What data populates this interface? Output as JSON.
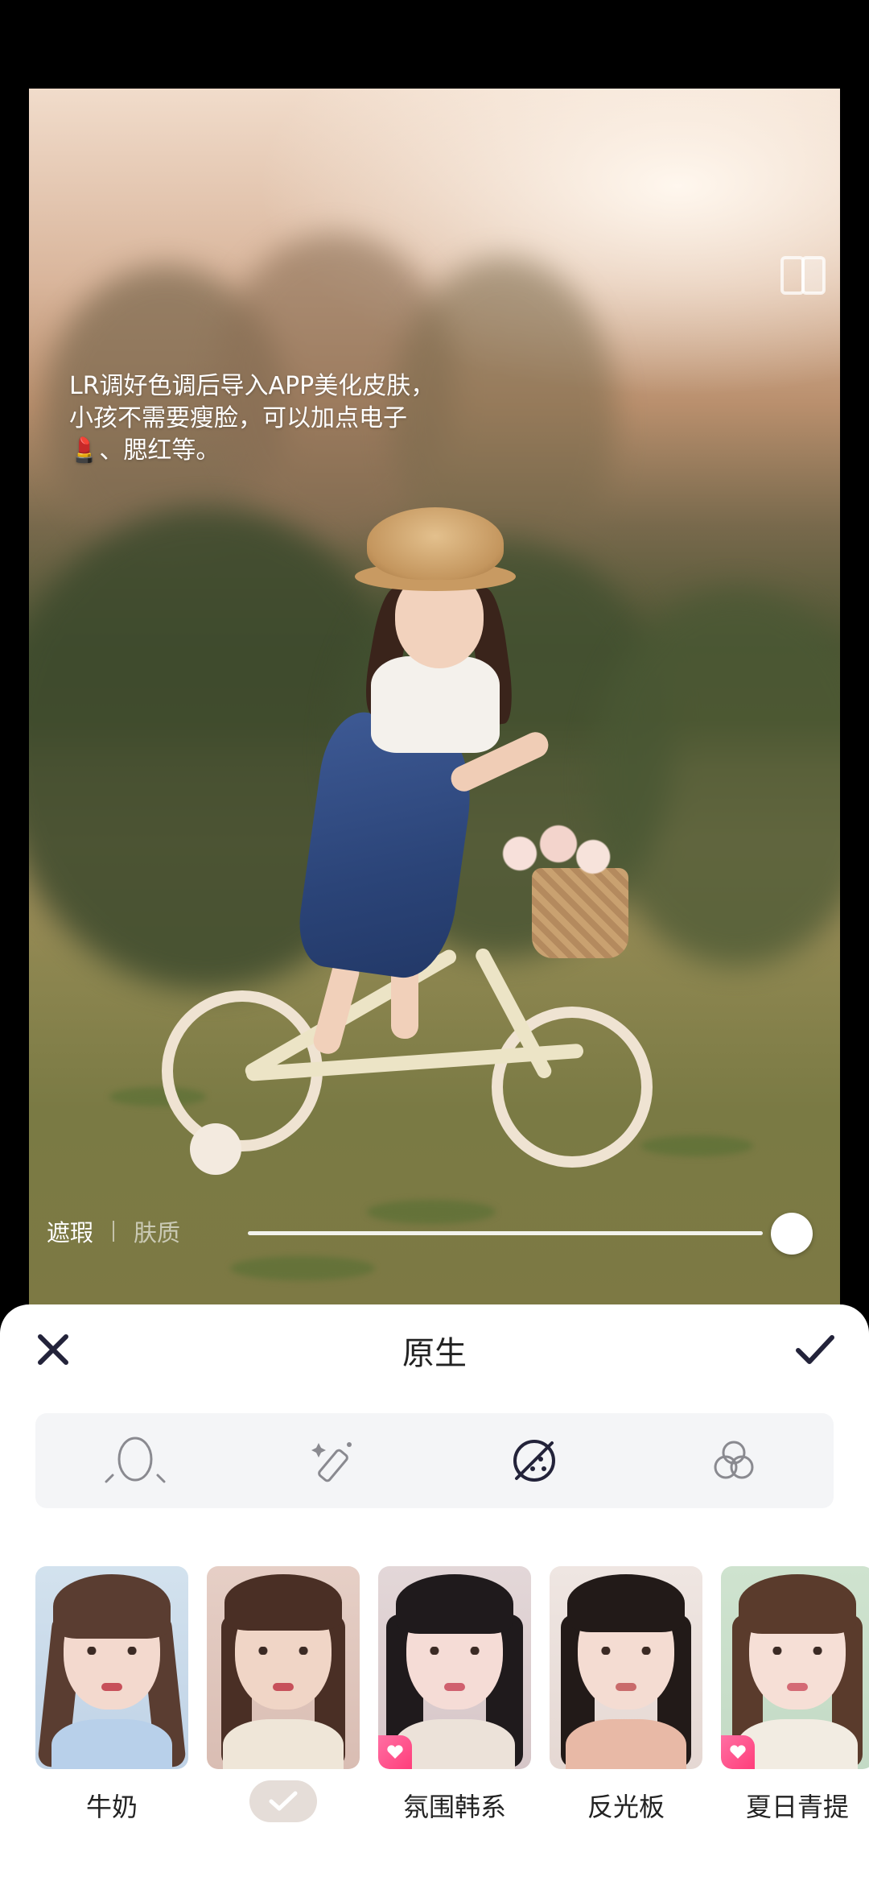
{
  "photo": {
    "caption": "LR调好色调后导入APP美化皮肤，\n小孩不需要瘦脸，可以加点电子\n💄、腮红等。",
    "mode_selected": "遮瑕",
    "mode_other": "肤质",
    "slider_value_percent": 100
  },
  "panel": {
    "title": "原生",
    "close_icon": "close-icon",
    "confirm_icon": "checkmark-icon"
  },
  "tools": [
    {
      "icon": "face-outline-icon",
      "active": false
    },
    {
      "icon": "magic-wand-icon",
      "active": false
    },
    {
      "icon": "skin-texture-icon",
      "active": true
    },
    {
      "icon": "color-circles-icon",
      "active": false
    }
  ],
  "styles": [
    {
      "label": "牛奶",
      "vip": false,
      "selected": false
    },
    {
      "label": "",
      "vip": false,
      "selected": true
    },
    {
      "label": "氛围韩系",
      "vip": true,
      "selected": false
    },
    {
      "label": "反光板",
      "vip": false,
      "selected": false
    },
    {
      "label": "夏日青提",
      "vip": true,
      "selected": false
    }
  ],
  "colors": {
    "accent_vip": "#ff3e7b",
    "panel_bg": "#ffffff",
    "tabs_bg": "#f4f5f7"
  }
}
